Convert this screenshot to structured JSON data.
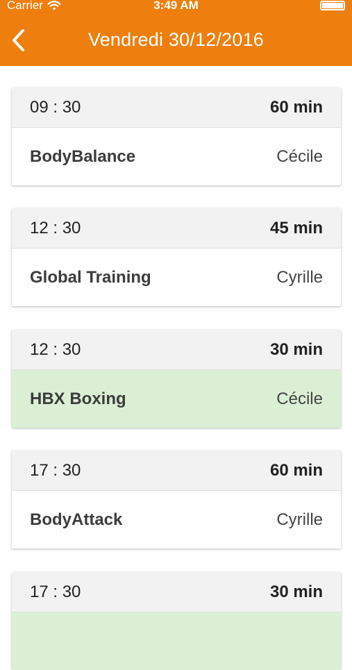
{
  "status_bar": {
    "carrier": "Carrier",
    "time": "3:49 AM",
    "wifi_icon": "wifi-icon",
    "battery_icon": "battery-icon"
  },
  "navbar": {
    "back_icon": "chevron-left-icon",
    "title": "Vendredi 30/12/2016"
  },
  "colors": {
    "header": "#EE7F0E",
    "card_header": "#F2F2F2",
    "booked_highlight": "#DBEFD5"
  },
  "sessions": [
    {
      "time": "09 : 30",
      "duration": "60 min",
      "name": "BodyBalance",
      "coach": "Cécile",
      "booked": false
    },
    {
      "time": "12 : 30",
      "duration": "45 min",
      "name": "Global Training",
      "coach": "Cyrille",
      "booked": false
    },
    {
      "time": "12 : 30",
      "duration": "30 min",
      "name": "HBX Boxing",
      "coach": "Cécile",
      "booked": true
    },
    {
      "time": "17 : 30",
      "duration": "60 min",
      "name": "BodyAttack",
      "coach": "Cyrille",
      "booked": false
    },
    {
      "time": "17 : 30",
      "duration": "30 min",
      "name": "",
      "coach": "",
      "booked": true
    }
  ]
}
